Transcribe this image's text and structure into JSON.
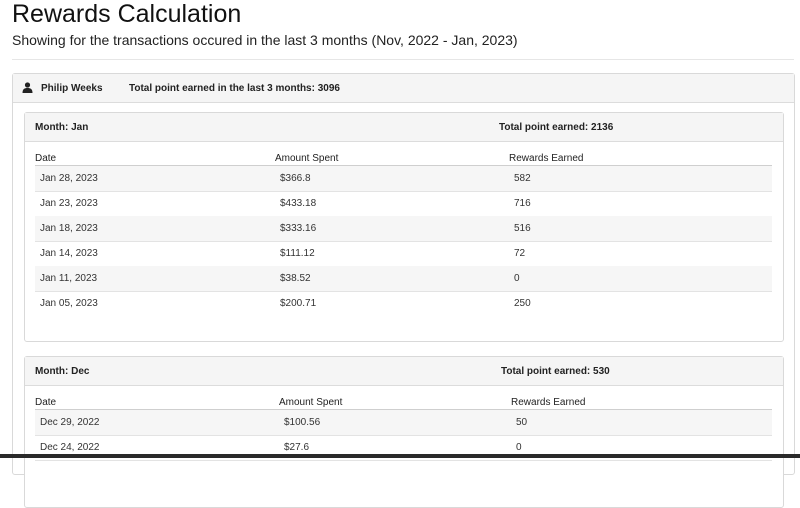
{
  "page": {
    "title": "Rewards Calculation",
    "subtitle": "Showing for the transactions occured in the last 3 months (Nov, 2022 - Jan, 2023)"
  },
  "customer": {
    "icon": "user-icon",
    "name": "Philip Weeks",
    "total_label": "Total point earned in the last 3 months: 3096"
  },
  "months": [
    {
      "label": "Month: Jan",
      "total": "Total point earned: 2136",
      "columns": [
        "Date",
        "Amount Spent",
        "Rewards Earned"
      ],
      "rows": [
        {
          "date": "Jan 28, 2023",
          "amount": "$366.8",
          "rewards": "582"
        },
        {
          "date": "Jan 23, 2023",
          "amount": "$433.18",
          "rewards": "716"
        },
        {
          "date": "Jan 18, 2023",
          "amount": "$333.16",
          "rewards": "516"
        },
        {
          "date": "Jan 14, 2023",
          "amount": "$111.12",
          "rewards": "72"
        },
        {
          "date": "Jan 11, 2023",
          "amount": "$38.52",
          "rewards": "0"
        },
        {
          "date": "Jan 05, 2023",
          "amount": "$200.71",
          "rewards": "250"
        }
      ]
    },
    {
      "label": "Month: Dec",
      "total": "Total point earned: 530",
      "columns": [
        "Date",
        "Amount Spent",
        "Rewards Earned"
      ],
      "rows": [
        {
          "date": "Dec 29, 2022",
          "amount": "$100.56",
          "rewards": "50"
        },
        {
          "date": "Dec 24, 2022",
          "amount": "$27.6",
          "rewards": "0"
        }
      ]
    }
  ]
}
